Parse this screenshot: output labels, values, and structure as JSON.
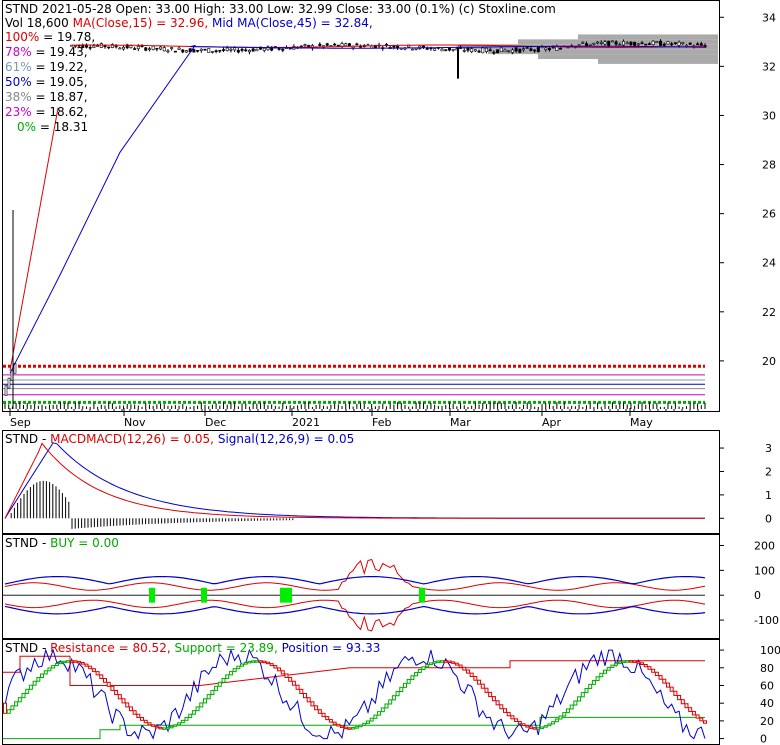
{
  "colors": {
    "red": "#dd0000",
    "blue": "#0000cc",
    "green": "#00aa00",
    "bright_green": "#00ee00",
    "gray": "#999999",
    "black": "#000000"
  },
  "main": {
    "header_line1": "STND  2021-05-28 Open: 33.00  High: 33.00  Low: 32.99  Close: 33.00 (0.1%)  (c) Stoxline.com",
    "vol_label": "Vol 18,600",
    "ma15_label": "MA(Close,15) = 32.96,",
    "ma45_label": "Mid MA(Close,45) = 32.84,",
    "fib_levels": [
      {
        "label": "100% = 19.78,",
        "color": "#dd0000",
        "value": 19.78
      },
      {
        "label": "78% = 19.43,",
        "color": "#cc00cc",
        "value": 19.43
      },
      {
        "label": "61% = 19.22,",
        "color": "#7799bb",
        "value": 19.22
      },
      {
        "label": "50% = 19.05,",
        "color": "#0000cc",
        "value": 19.05
      },
      {
        "label": "38% = 18.87,",
        "color": "#888888",
        "value": 18.87
      },
      {
        "label": "23% = 18.62,",
        "color": "#cc00cc",
        "value": 18.62
      },
      {
        "label": "0% = 18.31",
        "color": "#00aa00",
        "value": 18.31
      }
    ],
    "x_labels": [
      "Sep",
      "Nov",
      "Dec",
      "2021",
      "Feb",
      "Mar",
      "Apr",
      "May"
    ],
    "y_labels": [
      "34",
      "32",
      "30",
      "28",
      "26",
      "24",
      "22",
      "20"
    ]
  },
  "macd": {
    "prefix": "STND - ",
    "macd_label": "MACDMACD(12,26) = 0.05,",
    "signal_label": "Signal(12,26,9) = 0.05",
    "y_labels": [
      "3",
      "2",
      "1",
      "0"
    ]
  },
  "buy": {
    "prefix": "STND - ",
    "buy_label": "BUY = 0.00",
    "y_labels": [
      "200",
      "100",
      "0",
      "-100"
    ]
  },
  "srp": {
    "prefix": "STND - ",
    "resistance_label": "Resistance = 80.52,",
    "support_label": "Support = 23.89,",
    "position_label": "Position = 93.33",
    "y_labels": [
      "100",
      "80",
      "60",
      "40",
      "20",
      "0"
    ]
  },
  "chart_data": [
    {
      "type": "line",
      "title": "STND  2021-05-28 Open: 33.00  High: 33.00  Low: 32.99  Close: 33.00 (0.1%)  (c) Stoxline.com",
      "x": [
        "Sep",
        "Nov",
        "Dec",
        "2021",
        "Feb",
        "Mar",
        "Apr",
        "May"
      ],
      "ylim": [
        18.0,
        34.5
      ],
      "series": [
        {
          "name": "MA(Close,15)",
          "values": [
            19.2,
            32.8,
            32.85,
            32.75,
            32.7,
            32.75,
            32.7,
            32.9
          ]
        },
        {
          "name": "Mid MA(Close,45)",
          "values": [
            19.2,
            30.5,
            32.8,
            32.75,
            32.72,
            32.72,
            32.7,
            32.84
          ]
        }
      ],
      "fib": [
        19.78,
        19.43,
        19.22,
        19.05,
        18.87,
        18.62,
        18.31
      ]
    },
    {
      "type": "line",
      "title": "MACDMACD(12,26) = 0.05, Signal(12,26,9) = 0.05",
      "ylim": [
        0,
        3.5
      ],
      "series": [
        {
          "name": "MACD(12,26)",
          "values": [
            0.0,
            3.2,
            2.6,
            1.6,
            0.7,
            0.2,
            0.05,
            0.05
          ]
        },
        {
          "name": "Signal(12,26,9)",
          "values": [
            0.0,
            2.0,
            3.3,
            2.2,
            1.0,
            0.3,
            0.05,
            0.05
          ]
        }
      ]
    },
    {
      "type": "line",
      "title": "BUY = 0.00",
      "ylim": [
        -150,
        220
      ],
      "series": [
        {
          "name": "BUY",
          "values": [
            0,
            0,
            0,
            0,
            0,
            0,
            0,
            0
          ]
        }
      ]
    },
    {
      "type": "line",
      "title": "Resistance = 80.52, Support = 23.89, Position = 93.33",
      "ylim": [
        0,
        105
      ],
      "series": [
        {
          "name": "Resistance",
          "values": [
            75,
            60,
            55,
            60,
            80,
            88,
            90,
            80.52
          ]
        },
        {
          "name": "Support",
          "values": [
            5,
            15,
            15,
            15,
            15,
            15,
            23,
            23.89
          ]
        },
        {
          "name": "Position",
          "values": [
            20,
            60,
            30,
            70,
            40,
            90,
            60,
            93.33
          ]
        }
      ]
    }
  ]
}
